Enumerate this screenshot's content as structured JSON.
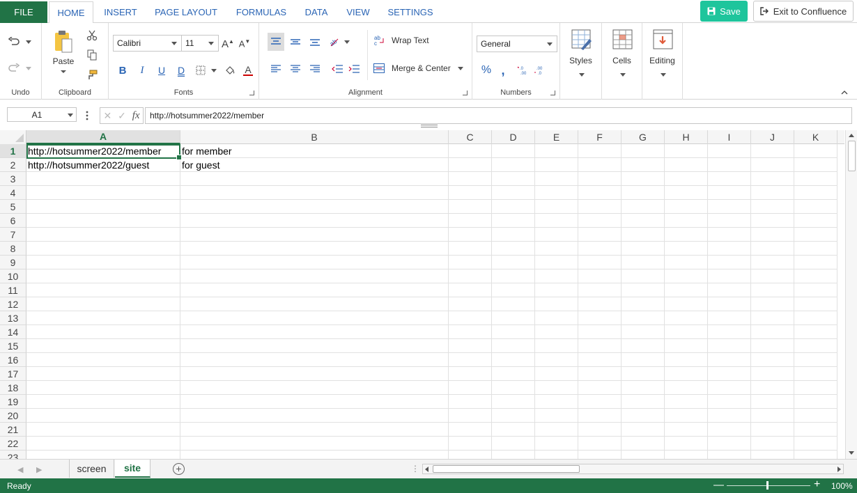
{
  "tabs": {
    "file": "FILE",
    "items": [
      "HOME",
      "INSERT",
      "PAGE LAYOUT",
      "FORMULAS",
      "DATA",
      "VIEW",
      "SETTINGS"
    ],
    "active": "HOME"
  },
  "actions": {
    "save": "Save",
    "exit": "Exit to Confluence"
  },
  "ribbon": {
    "undo_group": "Undo",
    "clipboard_group": "Clipboard",
    "paste": "Paste",
    "fonts_group": "Fonts",
    "font_name": "Calibri",
    "font_size": "11",
    "alignment_group": "Alignment",
    "wrap_text": "Wrap Text",
    "merge_center": "Merge & Center",
    "numbers_group": "Numbers",
    "number_format": "General",
    "styles": "Styles",
    "cells": "Cells",
    "editing": "Editing"
  },
  "formula_bar": {
    "name_box": "A1",
    "fx": "fx",
    "content": "http://hotsummer2022/member"
  },
  "grid": {
    "columns": [
      "A",
      "B",
      "C",
      "D",
      "E",
      "F",
      "G",
      "H",
      "I",
      "J",
      "K"
    ],
    "rows": [
      "1",
      "2",
      "3",
      "4",
      "5",
      "6",
      "7",
      "8",
      "9",
      "10",
      "11",
      "12",
      "13",
      "14",
      "15",
      "16",
      "17",
      "18",
      "19",
      "20",
      "21",
      "22",
      "23"
    ],
    "cells": {
      "A1": "http://hotsummer2022/member",
      "B1": "for member",
      "A2": "http://hotsummer2022/guest",
      "B2": "for guest"
    },
    "selected": "A1"
  },
  "sheets": {
    "tabs": [
      "screen",
      "site"
    ],
    "active": "site"
  },
  "status": {
    "text": "Ready",
    "zoom": "100%"
  },
  "colors": {
    "accent": "#217346",
    "save": "#1ec59c",
    "tab_text": "#2b65b5"
  }
}
